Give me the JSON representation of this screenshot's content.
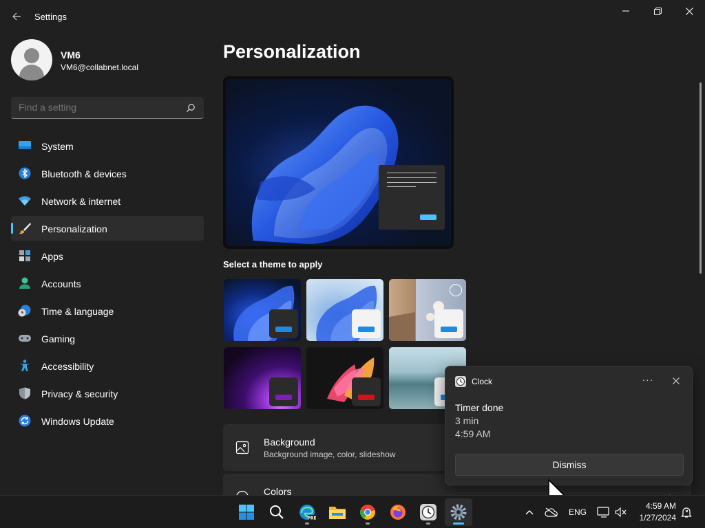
{
  "window": {
    "title": "Settings"
  },
  "profile": {
    "name": "VM6",
    "email": "VM6@collabnet.local"
  },
  "search": {
    "placeholder": "Find a setting"
  },
  "nav": {
    "items": [
      {
        "label": "System",
        "icon": "system-icon"
      },
      {
        "label": "Bluetooth & devices",
        "icon": "bluetooth-icon"
      },
      {
        "label": "Network & internet",
        "icon": "wifi-icon"
      },
      {
        "label": "Personalization",
        "icon": "brush-icon",
        "active": true
      },
      {
        "label": "Apps",
        "icon": "apps-icon"
      },
      {
        "label": "Accounts",
        "icon": "account-icon"
      },
      {
        "label": "Time & language",
        "icon": "globe-clock-icon"
      },
      {
        "label": "Gaming",
        "icon": "gamepad-icon"
      },
      {
        "label": "Accessibility",
        "icon": "accessibility-icon"
      },
      {
        "label": "Privacy & security",
        "icon": "shield-icon"
      },
      {
        "label": "Windows Update",
        "icon": "update-icon"
      }
    ]
  },
  "main": {
    "title": "Personalization",
    "themes_heading": "Select a theme to apply",
    "settings": [
      {
        "title": "Background",
        "subtitle": "Background image, color, slideshow",
        "icon": "image-icon"
      },
      {
        "title": "Colors",
        "subtitle": "",
        "icon": "palette-icon"
      }
    ]
  },
  "notification": {
    "app": "Clock",
    "title": "Timer done",
    "line1": "3 min",
    "line2": "4:59 AM",
    "button": "Dismiss"
  },
  "taskbar": {
    "apps": [
      "start-icon",
      "search-icon",
      "edge-icon",
      "file-explorer-icon",
      "chrome-icon",
      "firefox-icon",
      "clock-app-icon",
      "settings-icon"
    ],
    "language": "ENG",
    "time": "4:59 AM",
    "date": "1/27/2024"
  },
  "colors": {
    "accent": "#4cc2ff",
    "background": "#202020",
    "card": "#2b2b2b"
  }
}
